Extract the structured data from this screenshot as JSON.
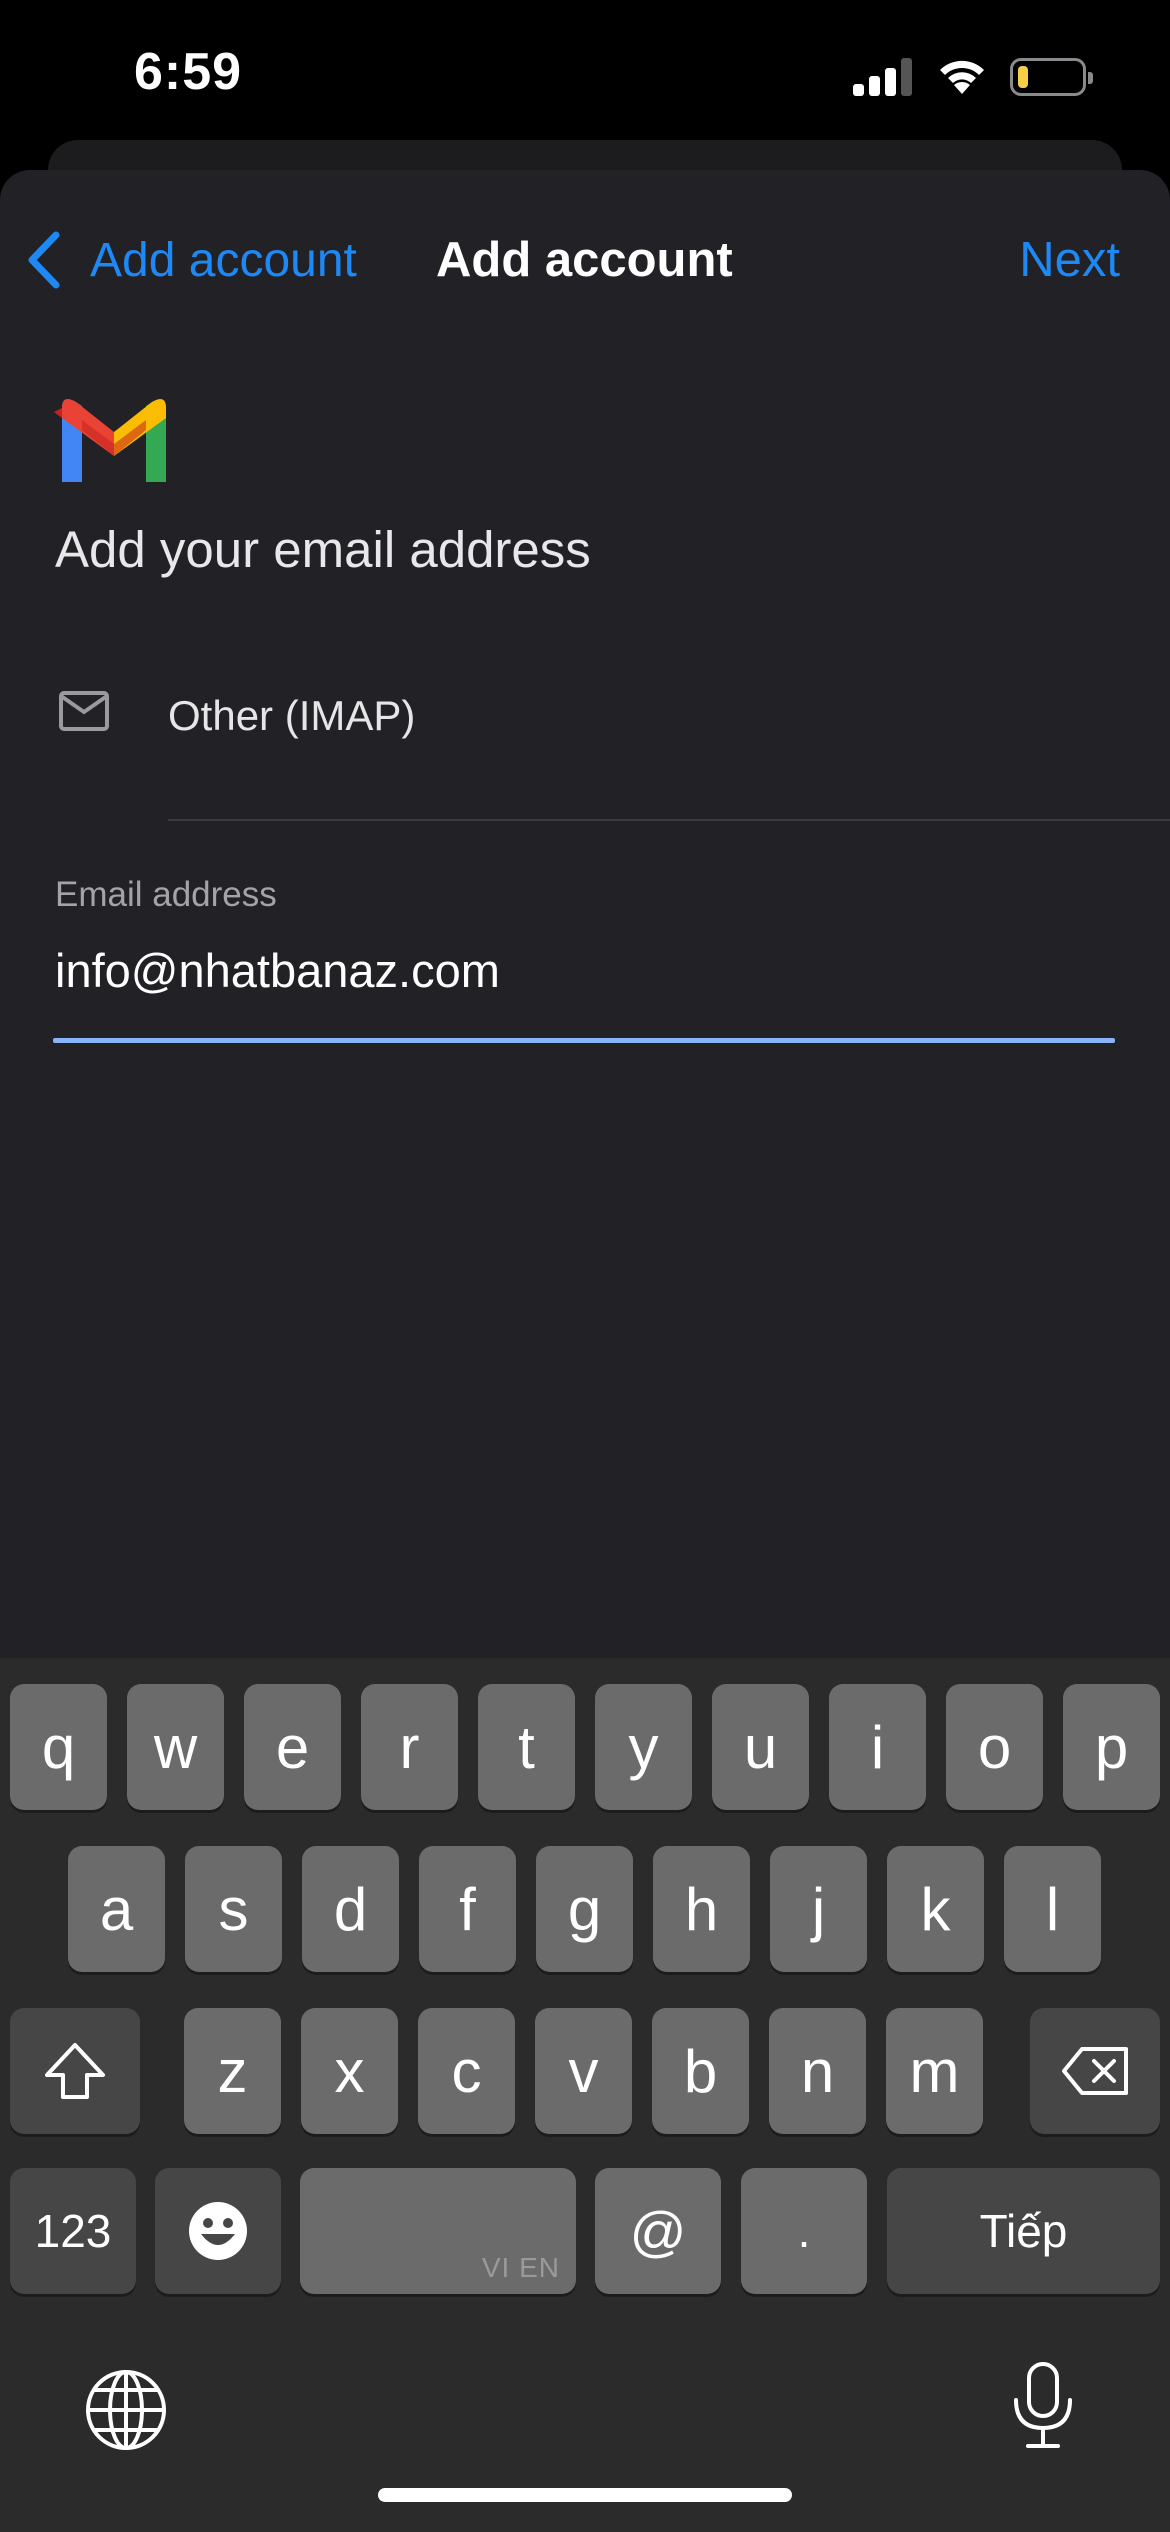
{
  "status_bar": {
    "time": "6:59",
    "battery_level": 0.15
  },
  "nav": {
    "back_label": "Add account",
    "title": "Add account",
    "next_label": "Next"
  },
  "content": {
    "heading": "Add your email address",
    "provider": {
      "icon": "mail-icon",
      "label": "Other (IMAP)"
    },
    "email_field": {
      "label": "Email address",
      "value": "info@nhatbanaz.com"
    }
  },
  "keyboard": {
    "row1": [
      "q",
      "w",
      "e",
      "r",
      "t",
      "y",
      "u",
      "i",
      "o",
      "p"
    ],
    "row2": [
      "a",
      "s",
      "d",
      "f",
      "g",
      "h",
      "j",
      "k",
      "l"
    ],
    "row3": [
      "z",
      "x",
      "c",
      "v",
      "b",
      "n",
      "m"
    ],
    "numbers_label": "123",
    "space_hint": "VI EN",
    "at_label": "@",
    "dot_label": ".",
    "return_label": "Tiếp",
    "icons": {
      "shift": "shift-icon",
      "delete": "delete-icon",
      "emoji": "emoji-icon",
      "globe": "globe-icon",
      "mic": "microphone-icon"
    }
  },
  "colors": {
    "accent": "#1e88f5",
    "field_focus": "#8ab4f8",
    "sheet_bg": "#222226",
    "keyboard_bg": "#2b2b2b"
  }
}
